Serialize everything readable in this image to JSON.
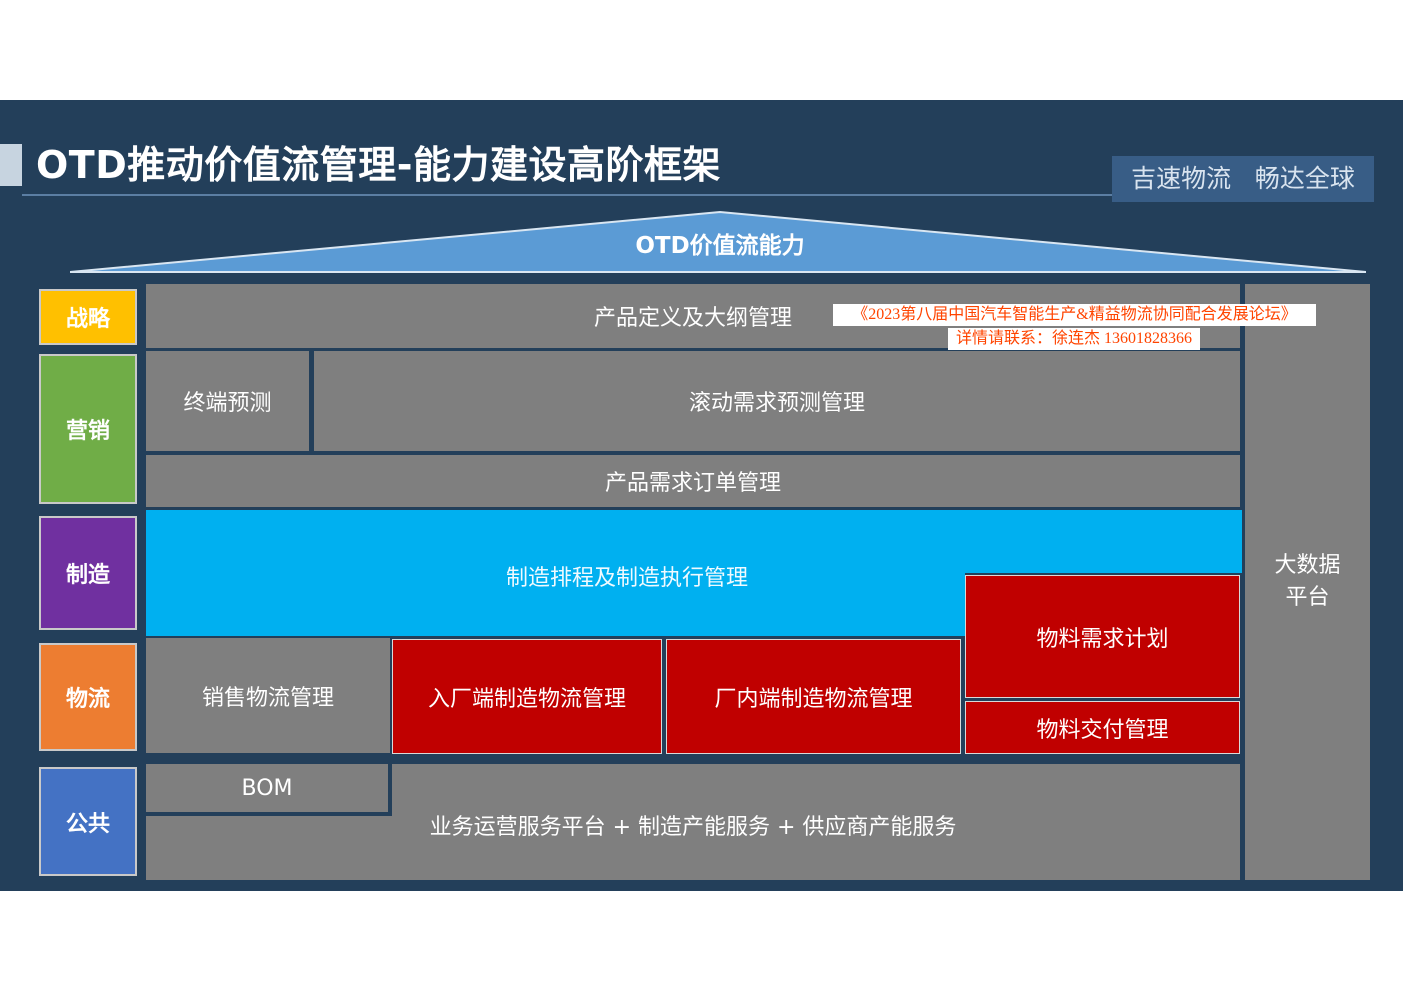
{
  "title": "OTD推动价值流管理-能力建设高阶框架",
  "slogan": "吉速物流   畅达全球",
  "roof_label": "OTD价值流能力",
  "colors": {
    "background": "#233f5a",
    "roof": "#5b9bd5",
    "grey_block": "#7f7f7f",
    "red_block": "#c00000",
    "cyan_block": "#00b0f0",
    "strategy": "#ffc000",
    "marketing": "#70ad47",
    "manufacturing": "#7030a0",
    "logistics": "#ed7d31",
    "public": "#4472c4",
    "watermark_text": "#ff4400"
  },
  "categories": {
    "strategy": "战略",
    "marketing": "营销",
    "manufacturing": "制造",
    "logistics": "物流",
    "public": "公共"
  },
  "blocks": {
    "product_definition": "产品定义及大纲管理",
    "terminal_forecast": "终端预测",
    "rolling_forecast": "滚动需求预测管理",
    "product_order": "产品需求订单管理",
    "manufacturing_schedule": "制造排程及制造执行管理",
    "sales_logistics": "销售物流管理",
    "inbound_logistics": "入厂端制造物流管理",
    "inplant_logistics": "厂内端制造物流管理",
    "material_planning": "物料需求计划",
    "material_delivery": "物料交付管理",
    "bom": "BOM",
    "service_platform": "业务运营服务平台 + 制造产能服务 + 供应商产能服务",
    "big_data_line1": "大数据",
    "big_data_line2": "平台"
  },
  "watermark": {
    "line1": "《2023第八届中国汽车智能生产&精益物流协同配合发展论坛》",
    "line2": "详情请联系：徐连杰 13601828366"
  }
}
